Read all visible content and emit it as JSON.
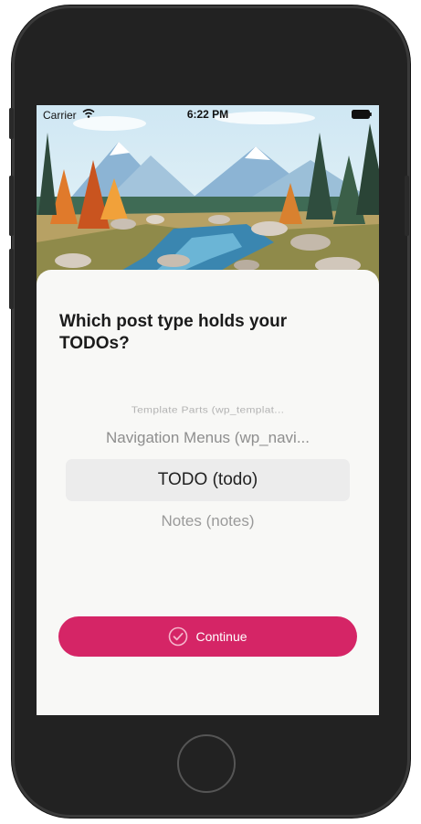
{
  "status_bar": {
    "carrier": "Carrier",
    "time": "6:22 PM",
    "wifi_icon": "wifi-icon",
    "battery_icon": "battery-icon"
  },
  "hero": {
    "description_icon": "landscape-illustration"
  },
  "prompt": {
    "question": "Which post type holds your TODOs?"
  },
  "picker": {
    "items": [
      "Template Parts (wp_templat...",
      "Navigation Menus (wp_navi...",
      "TODO (todo)",
      "Notes (notes)"
    ],
    "selected_index": 2
  },
  "actions": {
    "continue_label": "Continue",
    "continue_icon": "check-circle-icon"
  },
  "colors": {
    "accent": "#d52566",
    "sheet_bg": "#f8f8f6",
    "selection_bg": "#ececec"
  }
}
